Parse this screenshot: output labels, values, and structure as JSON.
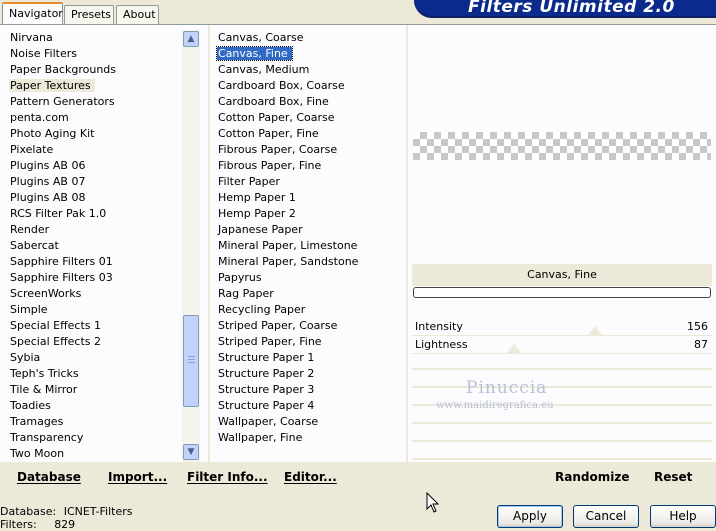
{
  "tabs": [
    {
      "label": "Navigator",
      "active": true
    },
    {
      "label": "Presets",
      "active": false
    },
    {
      "label": "About",
      "active": false
    }
  ],
  "banner": {
    "title": "Filters Unlimited 2.0"
  },
  "categories": {
    "items": [
      "Nirvana",
      "Noise Filters",
      "Paper Backgrounds",
      "Paper Textures",
      "Pattern Generators",
      "penta.com",
      "Photo Aging Kit",
      "Pixelate",
      "Plugins AB 06",
      "Plugins AB 07",
      "Plugins AB 08",
      "RCS Filter Pak 1.0",
      "Render",
      "Sabercat",
      "Sapphire Filters 01",
      "Sapphire Filters 03",
      "ScreenWorks",
      "Simple",
      "Special Effects 1",
      "Special Effects 2",
      "Sybia",
      "Teph's Tricks",
      "Tile & Mirror",
      "Toadies",
      "Tramages",
      "Transparency",
      "Two Moon"
    ],
    "selected": "Paper Textures"
  },
  "filters": {
    "items": [
      "Canvas, Coarse",
      "Canvas, Fine",
      "Canvas, Medium",
      "Cardboard Box, Coarse",
      "Cardboard Box, Fine",
      "Cotton Paper, Coarse",
      "Cotton Paper, Fine",
      "Fibrous Paper, Coarse",
      "Fibrous Paper, Fine",
      "Filter Paper",
      "Hemp Paper 1",
      "Hemp Paper 2",
      "Japanese Paper",
      "Mineral Paper, Limestone",
      "Mineral Paper, Sandstone",
      "Papyrus",
      "Rag Paper",
      "Recycling Paper",
      "Striped Paper, Coarse",
      "Striped Paper, Fine",
      "Structure Paper 1",
      "Structure Paper 2",
      "Structure Paper 3",
      "Structure Paper 4",
      "Wallpaper, Coarse",
      "Wallpaper, Fine"
    ],
    "selected": "Canvas, Fine"
  },
  "preview": {
    "filter_name": "Canvas, Fine",
    "progress": 0
  },
  "params": [
    {
      "label": "Intensity",
      "value": "156",
      "level": 0.61
    },
    {
      "label": "Lightness",
      "value": "87",
      "level": 0.34
    }
  ],
  "watermark": {
    "name": "Pinuccia",
    "url": "www.maidiregrafica.eu"
  },
  "bottom_links": {
    "database": "Database",
    "import": "Import...",
    "filter_info": "Filter Info...",
    "editor": "Editor...",
    "randomize": "Randomize",
    "reset": "Reset"
  },
  "status": {
    "database_label": "Database:",
    "database_value": "ICNET-Filters",
    "filters_label": "Filters:",
    "filters_value": "829"
  },
  "buttons": {
    "apply": "Apply",
    "cancel": "Cancel",
    "help": "Help"
  },
  "icons": {
    "scroll_up": "chevron-up-icon",
    "scroll_down": "chevron-down-icon",
    "cursor": "mouse-pointer-icon"
  }
}
